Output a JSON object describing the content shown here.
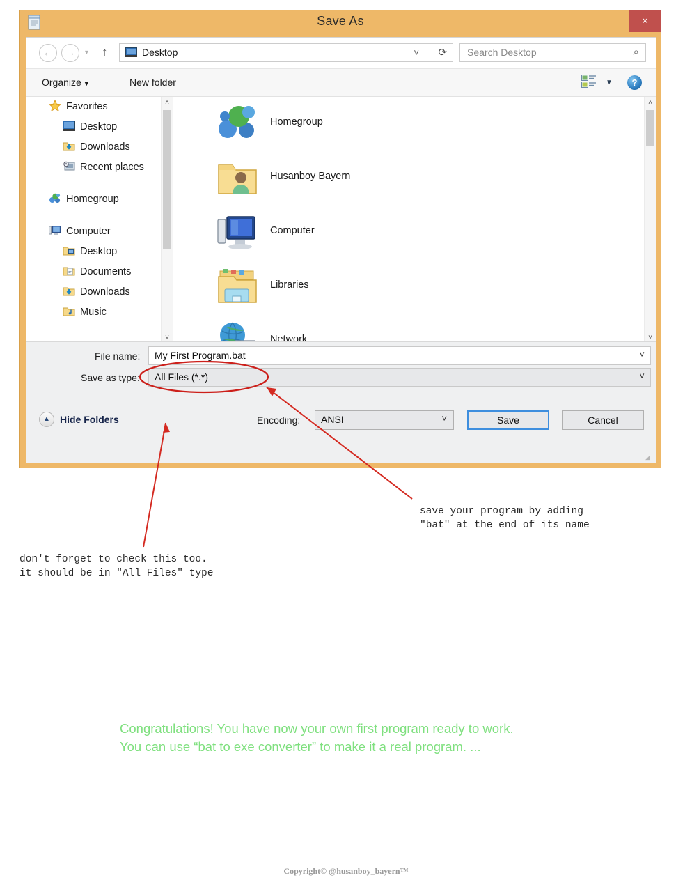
{
  "window": {
    "title": "Save As",
    "close_label": "×",
    "icon": "notepad-icon"
  },
  "nav": {
    "back": "←",
    "forward": "→",
    "history": "▾",
    "up": "↑",
    "address_value": "Desktop",
    "address_chevron": "˅",
    "refresh": "⟳",
    "search_placeholder": "Search Desktop",
    "search_icon": "⌕"
  },
  "toolbar": {
    "organize": "Organize",
    "organize_caret": "▼",
    "new_folder": "New folder",
    "viewmode_caret": "▼",
    "help": "?"
  },
  "sidebar": {
    "items": [
      {
        "label": "Favorites",
        "icon": "star-icon",
        "level": "root"
      },
      {
        "label": "Desktop",
        "icon": "desktop-icon",
        "level": "child"
      },
      {
        "label": "Downloads",
        "icon": "downloads-icon",
        "level": "child"
      },
      {
        "label": "Recent places",
        "icon": "recent-places-icon",
        "level": "child"
      },
      {
        "label": "Homegroup",
        "icon": "homegroup-icon",
        "level": "root"
      },
      {
        "label": "Computer",
        "icon": "computer-icon",
        "level": "root"
      },
      {
        "label": "Desktop",
        "icon": "desktop-folder-icon",
        "level": "child"
      },
      {
        "label": "Documents",
        "icon": "documents-icon",
        "level": "child"
      },
      {
        "label": "Downloads",
        "icon": "downloads-icon",
        "level": "child"
      },
      {
        "label": "Music",
        "icon": "music-icon",
        "level": "child"
      }
    ],
    "scroll_up": "˄",
    "scroll_down": "˅"
  },
  "filelist": {
    "items": [
      {
        "label": "Homegroup",
        "icon": "homegroup-icon"
      },
      {
        "label": "Husanboy Bayern",
        "icon": "user-folder-icon"
      },
      {
        "label": "Computer",
        "icon": "computer-icon"
      },
      {
        "label": "Libraries",
        "icon": "libraries-icon"
      },
      {
        "label": "Network",
        "icon": "network-icon"
      }
    ],
    "scroll_up": "˄",
    "scroll_down": "˅"
  },
  "form": {
    "filename_label": "File name:",
    "filename_value": "My First Program.bat",
    "savetype_label": "Save as type:",
    "savetype_value": "All Files  (*.*)",
    "dropdown_caret": "˅",
    "hide_folders": "Hide Folders",
    "hide_folders_caret": "▲",
    "encoding_label": "Encoding:",
    "encoding_value": "ANSI",
    "save_button": "Save",
    "cancel_button": "Cancel",
    "resize_grip": "◢"
  },
  "annotations": {
    "bat_note": "save your program by adding\n\"bat\" at the end of its name",
    "type_note": "don't forget to check this too.\nit should be in \"All Files\" type",
    "arrow_color": "#d42a21",
    "ellipse_color": "#cc1f1a"
  },
  "message": {
    "green_text": "Congratulations! You have now your own first program ready to work.\nYou can use “bat to exe converter” to make it a real program. ...",
    "green_color": "#7fe07f"
  },
  "footer": {
    "text": "Copyright© @husanboy_bayern™"
  }
}
